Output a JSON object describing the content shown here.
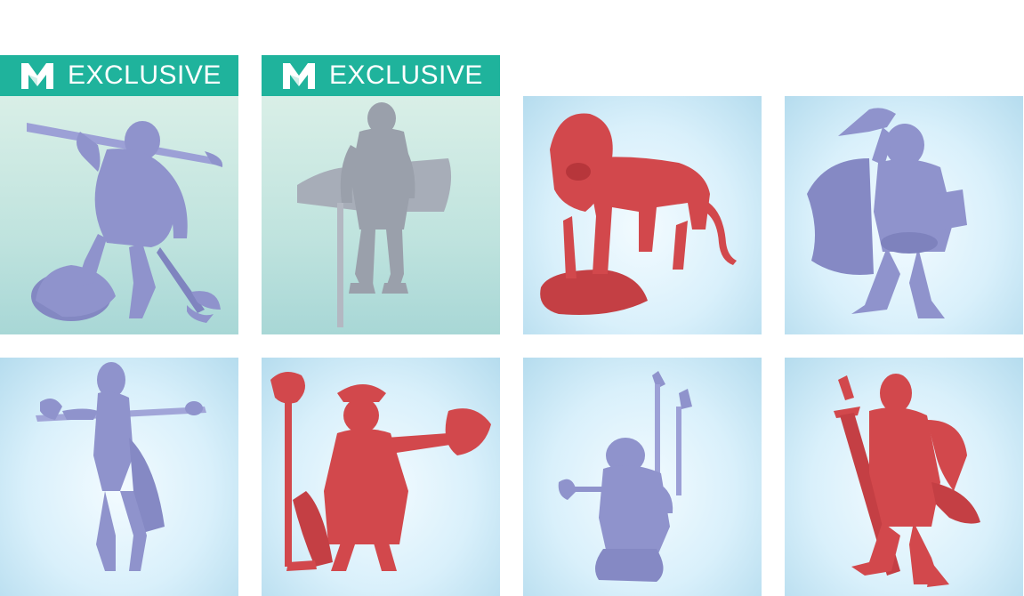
{
  "badges": [
    {
      "text": "EXCLUSIVE",
      "logo_letter": "M",
      "color": "#1fb39c"
    },
    {
      "text": "EXCLUSIVE",
      "logo_letter": "M",
      "color": "#1fb39c"
    }
  ],
  "colors": {
    "lavender": "#8f93cc",
    "grey": "#9aa0ab",
    "red": "#d2484c",
    "badge": "#1fb39c"
  },
  "figures": [
    {
      "icon": "warrior-sword-axe-miniature",
      "material": "lavender",
      "exclusive": true
    },
    {
      "icon": "armored-knight-miniature",
      "material": "grey",
      "exclusive": true
    },
    {
      "icon": "lion-miniature",
      "material": "red",
      "exclusive": false
    },
    {
      "icon": "dwarf-cleric-miniature",
      "material": "lavender",
      "exclusive": false
    },
    {
      "icon": "hooded-sorceress-miniature",
      "material": "lavender",
      "exclusive": false
    },
    {
      "icon": "fire-wizard-miniature",
      "material": "red",
      "exclusive": false
    },
    {
      "icon": "dwarf-torchbearer-miniature",
      "material": "lavender",
      "exclusive": false
    },
    {
      "icon": "paladin-greatsword-miniature",
      "material": "red",
      "exclusive": false
    }
  ]
}
